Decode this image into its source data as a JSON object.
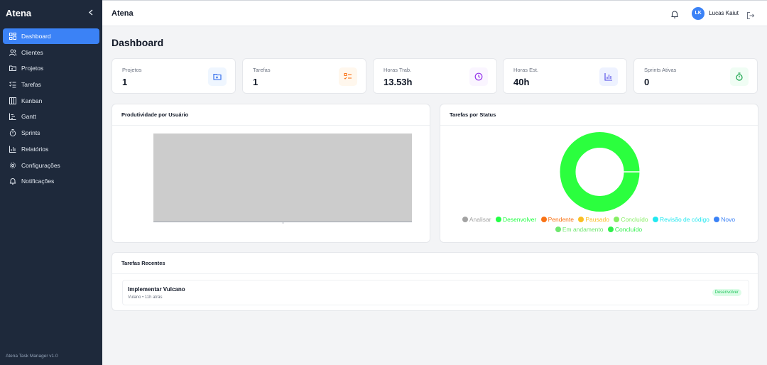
{
  "sidebar": {
    "title": "Atena",
    "collapse_icon": "chevron-left-icon",
    "items": [
      {
        "label": "Dashboard",
        "icon": "grid-icon",
        "active": true
      },
      {
        "label": "Clientes",
        "icon": "users-icon"
      },
      {
        "label": "Projetos",
        "icon": "folder-icon"
      },
      {
        "label": "Tarefas",
        "icon": "checklist-icon"
      },
      {
        "label": "Kanban",
        "icon": "columns-icon"
      },
      {
        "label": "Gantt",
        "icon": "gantt-icon"
      },
      {
        "label": "Sprints",
        "icon": "timer-icon"
      },
      {
        "label": "Relatórios",
        "icon": "bar-chart-icon"
      },
      {
        "label": "Configurações",
        "icon": "gear-icon"
      },
      {
        "label": "Notificações",
        "icon": "bell-icon"
      }
    ],
    "footer": "Atena Task Manager v1.0"
  },
  "topbar": {
    "title": "Atena",
    "user_initials": "LK",
    "user_name": "Lucas Kaiut"
  },
  "main": {
    "page_title": "Dashboard",
    "stats": [
      {
        "label": "Projetos",
        "value": "1",
        "icon": "folder-icon",
        "color": "#2563eb",
        "bg": "#eff6ff"
      },
      {
        "label": "Tarefas",
        "value": "1",
        "icon": "checklist-icon",
        "color": "#f97316",
        "bg": "#fff7ed"
      },
      {
        "label": "Horas Trab.",
        "value": "13.53h",
        "icon": "clock-icon",
        "color": "#9333ea",
        "bg": "#faf5ff"
      },
      {
        "label": "Horas Est.",
        "value": "40h",
        "icon": "bar-chart-icon",
        "color": "#4f46e5",
        "bg": "#eef2ff"
      },
      {
        "label": "Sprints Ativas",
        "value": "0",
        "icon": "timer-icon",
        "color": "#16a34a",
        "bg": "#f0fdf4"
      }
    ],
    "productivity": {
      "title": "Produtividade por Usuário"
    },
    "status_chart": {
      "title": "Tarefas por Status",
      "legend": [
        {
          "label": "Analisar",
          "color": "#a3a3a3"
        },
        {
          "label": "Desenvolver",
          "color": "#22ff44"
        },
        {
          "label": "Pendente",
          "color": "#f97316"
        },
        {
          "label": "Pausado",
          "color": "#fbbf24"
        },
        {
          "label": "Concluído",
          "color": "#86ef63"
        },
        {
          "label": "Revisão de código",
          "color": "#22e8f0"
        },
        {
          "label": "Novo",
          "color": "#3b82f6"
        },
        {
          "label": "Em andamento",
          "color": "#6ee76e"
        },
        {
          "label": "Concluído",
          "color": "#2ef04a"
        }
      ]
    },
    "recent": {
      "title": "Tarefas Recentes",
      "items": [
        {
          "title": "Implementar Vulcano",
          "subtitle": "Vulano • 11h atrás",
          "status": "Desenvolver"
        }
      ]
    }
  },
  "chart_data": {
    "type": "pie",
    "title": "Tarefas por Status",
    "categories": [
      "Analisar",
      "Desenvolver",
      "Pendente",
      "Pausado",
      "Concluído",
      "Revisão de código",
      "Novo",
      "Em andamento",
      "Concluído"
    ],
    "values": [
      0,
      1,
      0,
      0,
      0,
      0,
      0,
      0,
      0
    ],
    "donut": true,
    "legend": "bottom"
  }
}
